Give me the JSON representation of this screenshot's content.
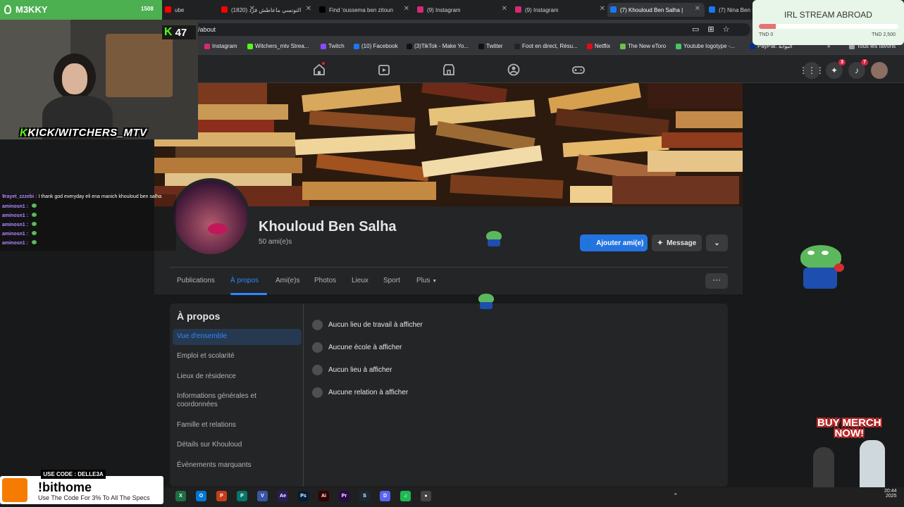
{
  "overlay": {
    "channel": "M3KKY",
    "channel_count": "1508",
    "viewers": "47",
    "kick_handle": "KICK/WITCHERS_MTV",
    "chat": [
      {
        "user": "9rayet_zzzebi :",
        "msg": "I thank god everyday eli ena manich khouloud ben salha"
      },
      {
        "user": "aminosn1 :",
        "msg": ""
      },
      {
        "user": "aminosn1 :",
        "msg": ""
      },
      {
        "user": "aminosn1 :",
        "msg": ""
      },
      {
        "user": "aminosn1 :",
        "msg": ""
      },
      {
        "user": "aminosn1 :",
        "msg": ""
      }
    ],
    "goal": {
      "title": "IRL STREAM ABROAD",
      "min": "TND 0",
      "max": "TND 2,500",
      "progress": 0.12,
      "bar_label": "310"
    },
    "merch": [
      "BUY MERCH",
      "NOW!"
    ],
    "sponsor": {
      "code": "USE CODE : DELLE3A",
      "cmd": "!bithome",
      "sub": "Use The Code For 3% To All The Specs",
      "logo": "BIT HOME"
    }
  },
  "browser": {
    "tabs": [
      {
        "label": "ube",
        "fav": "#ff0000",
        "active": false
      },
      {
        "label": "(1820) التونسي ماعاطش فرد",
        "fav": "#ff0000",
        "active": false
      },
      {
        "label": "Find 'oussema ben zitoun",
        "fav": "#000000",
        "active": false
      },
      {
        "label": "(9) Instagram",
        "fav": "#d62976",
        "active": false
      },
      {
        "label": "(9) Instagram",
        "fav": "#d62976",
        "active": false
      },
      {
        "label": "(7) Khouloud Ben Salha |",
        "fav": "#1877f2",
        "active": true
      },
      {
        "label": "(7) Nina Ben S",
        "fav": "#1877f2",
        "active": false
      }
    ],
    "url": "/about",
    "bookmarks": [
      {
        "label": "Instagram",
        "color": "#d62976"
      },
      {
        "label": "Witchers_mtv Strea...",
        "color": "#53fc18"
      },
      {
        "label": "Twitch",
        "color": "#9146ff"
      },
      {
        "label": "(10) Facebook",
        "color": "#1877f2"
      },
      {
        "label": "(3)TikTok - Make Yo...",
        "color": "#111111"
      },
      {
        "label": "Twitter",
        "color": "#111111"
      },
      {
        "label": "Foot en direct, Résu...",
        "color": "#222222"
      },
      {
        "label": "Netflix",
        "color": "#e50914"
      },
      {
        "label": "The New eToro",
        "color": "#6cc04a"
      },
      {
        "label": "Youtube logotype -...",
        "color": "#44c767"
      },
      {
        "label": "PayPal: البوابة",
        "color": "#003087"
      }
    ],
    "bookmarks_more": "»",
    "all_bookmarks": "Tous les favoris"
  },
  "facebook": {
    "messenger_badge": "3",
    "notif_badge": "7",
    "profile": {
      "name": "Khouloud Ben Salha",
      "friends": "50 ami(e)s"
    },
    "actions": {
      "add_friend": "Ajouter ami(e)",
      "message": "Message",
      "more": "⌄"
    },
    "tabs": [
      "Publications",
      "À propos",
      "Ami(e)s",
      "Photos",
      "Lieux",
      "Sport",
      "Plus"
    ],
    "active_tab": 1,
    "about": {
      "heading": "À propos",
      "sidebar": [
        "Vue d'ensemble",
        "Emploi et scolarité",
        "Lieux de résidence",
        "Informations générales et coordonnées",
        "Famille et relations",
        "Détails sur Khouloud",
        "Évènements marquants"
      ],
      "rows": [
        {
          "label": "Aucun lieu de travail à afficher",
          "icon": "briefcase-icon"
        },
        {
          "label": "Aucune école à afficher",
          "icon": "graduation-cap-icon"
        },
        {
          "label": "Aucun lieu à afficher",
          "icon": "location-pin-icon"
        },
        {
          "label": "Aucune relation à afficher",
          "icon": "heart-icon"
        }
      ]
    }
  },
  "taskbar": {
    "apps": [
      {
        "name": "excel",
        "label": "X",
        "color": "#1d6f42"
      },
      {
        "name": "outlook",
        "label": "O",
        "color": "#0078d4"
      },
      {
        "name": "powerpoint",
        "label": "P",
        "color": "#c43e1c"
      },
      {
        "name": "publisher",
        "label": "P",
        "color": "#077568"
      },
      {
        "name": "visio",
        "label": "V",
        "color": "#3955a3"
      },
      {
        "name": "after-effects",
        "label": "Ae",
        "color": "#2b1b5a"
      },
      {
        "name": "photoshop",
        "label": "Ps",
        "color": "#001e36"
      },
      {
        "name": "illustrator",
        "label": "Ai",
        "color": "#330000"
      },
      {
        "name": "premiere",
        "label": "Pr",
        "color": "#2a0a4a"
      },
      {
        "name": "steam",
        "label": "S",
        "color": "#1b2838"
      },
      {
        "name": "discord",
        "label": "D",
        "color": "#5865f2"
      },
      {
        "name": "spotify",
        "label": "♫",
        "color": "#1db954"
      },
      {
        "name": "chrome",
        "label": "●",
        "color": "#444444"
      }
    ],
    "time": "20:44",
    "date": "2025"
  }
}
